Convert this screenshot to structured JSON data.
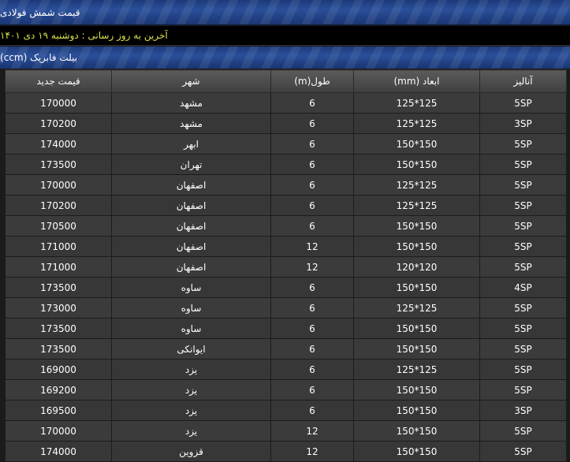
{
  "header": {
    "title": "قیمت شمش فولادی"
  },
  "update": {
    "text": "آخرین به روز رسانی : دوشنبه ۱۹ دی ۱۴۰۱"
  },
  "section": {
    "title": "بیلت فابریک (ccm)"
  },
  "table": {
    "columns": [
      "آنالیز",
      "ابعاد (mm)",
      "طول(m)",
      "شهر",
      "قیمت جدید"
    ],
    "rows": [
      [
        "5SP",
        "125*125",
        "6",
        "مشهد",
        "170000"
      ],
      [
        "3SP",
        "125*125",
        "6",
        "مشهد",
        "170200"
      ],
      [
        "5SP",
        "150*150",
        "6",
        "ابهر",
        "174000"
      ],
      [
        "5SP",
        "150*150",
        "6",
        "تهران",
        "173500"
      ],
      [
        "5SP",
        "125*125",
        "6",
        "اصفهان",
        "170000"
      ],
      [
        "5SP",
        "125*125",
        "6",
        "اصفهان",
        "170200"
      ],
      [
        "5SP",
        "150*150",
        "6",
        "اصفهان",
        "170500"
      ],
      [
        "5SP",
        "150*150",
        "12",
        "اصفهان",
        "171000"
      ],
      [
        "5SP",
        "120*120",
        "12",
        "اصفهان",
        "171000"
      ],
      [
        "4SP",
        "150*150",
        "6",
        "ساوه",
        "173500"
      ],
      [
        "5SP",
        "125*125",
        "6",
        "ساوه",
        "173000"
      ],
      [
        "5SP",
        "150*150",
        "6",
        "ساوه",
        "173500"
      ],
      [
        "5SP",
        "150*150",
        "6",
        "ایوانکی",
        "173500"
      ],
      [
        "5SP",
        "125*125",
        "6",
        "یزد",
        "169000"
      ],
      [
        "5SP",
        "150*150",
        "6",
        "یزد",
        "169200"
      ],
      [
        "3SP",
        "150*150",
        "6",
        "یزد",
        "169500"
      ],
      [
        "5SP",
        "150*150",
        "12",
        "یزد",
        "170000"
      ],
      [
        "5SP",
        "150*150",
        "12",
        "قزوین",
        "174000"
      ]
    ]
  }
}
